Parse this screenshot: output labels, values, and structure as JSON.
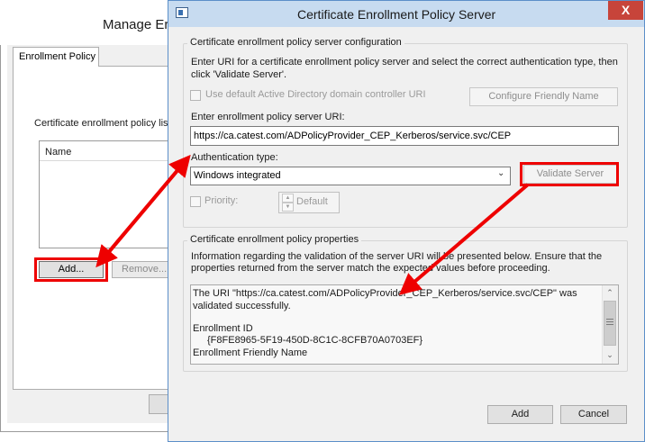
{
  "back_dialog": {
    "title": "Manage Er",
    "tab_label": "Enrollment Policy",
    "list_label": "Certificate enrollment policy list",
    "list_column": "Name",
    "add_button": "Add...",
    "remove_button": "Remove..."
  },
  "dialog": {
    "title": "Certificate Enrollment Policy Server",
    "close_glyph": "X",
    "config_group": {
      "title": "Certificate enrollment policy server configuration",
      "intro_line1": "Enter URI for a certificate enrollment policy server and select the correct authentication type, then",
      "intro_line2": "click 'Validate Server'.",
      "use_default_label": "Use default Active Directory domain controller URI",
      "configure_button": "Configure Friendly Name",
      "uri_label": "Enter enrollment policy server URI:",
      "uri_value": "https://ca.catest.com/ADPolicyProvider_CEP_Kerberos/service.svc/CEP",
      "auth_label": "Authentication type:",
      "auth_value": "Windows integrated",
      "validate_button": "Validate Server",
      "priority_label": "Priority:",
      "priority_value": "Default"
    },
    "properties_group": {
      "title": "Certificate enrollment policy properties",
      "info_line1": "Information regarding the validation of the server URI will be presented below. Ensure that the",
      "info_line2": "properties returned from the server match the expected values before proceeding.",
      "result_lines": [
        "The URI \"https://ca.catest.com/ADPolicyProvider_CEP_Kerberos/service.svc/CEP\" was",
        "validated successfully.",
        "Enrollment ID",
        "{F8FE8965-5F19-450D-8C1C-8CFB70A0703EF}",
        "Enrollment Friendly Name"
      ]
    },
    "add_button": "Add",
    "cancel_button": "Cancel"
  },
  "colors": {
    "highlight": "#ee0000",
    "titlebar": "#c7dbf0",
    "close_button": "#c7443a"
  }
}
